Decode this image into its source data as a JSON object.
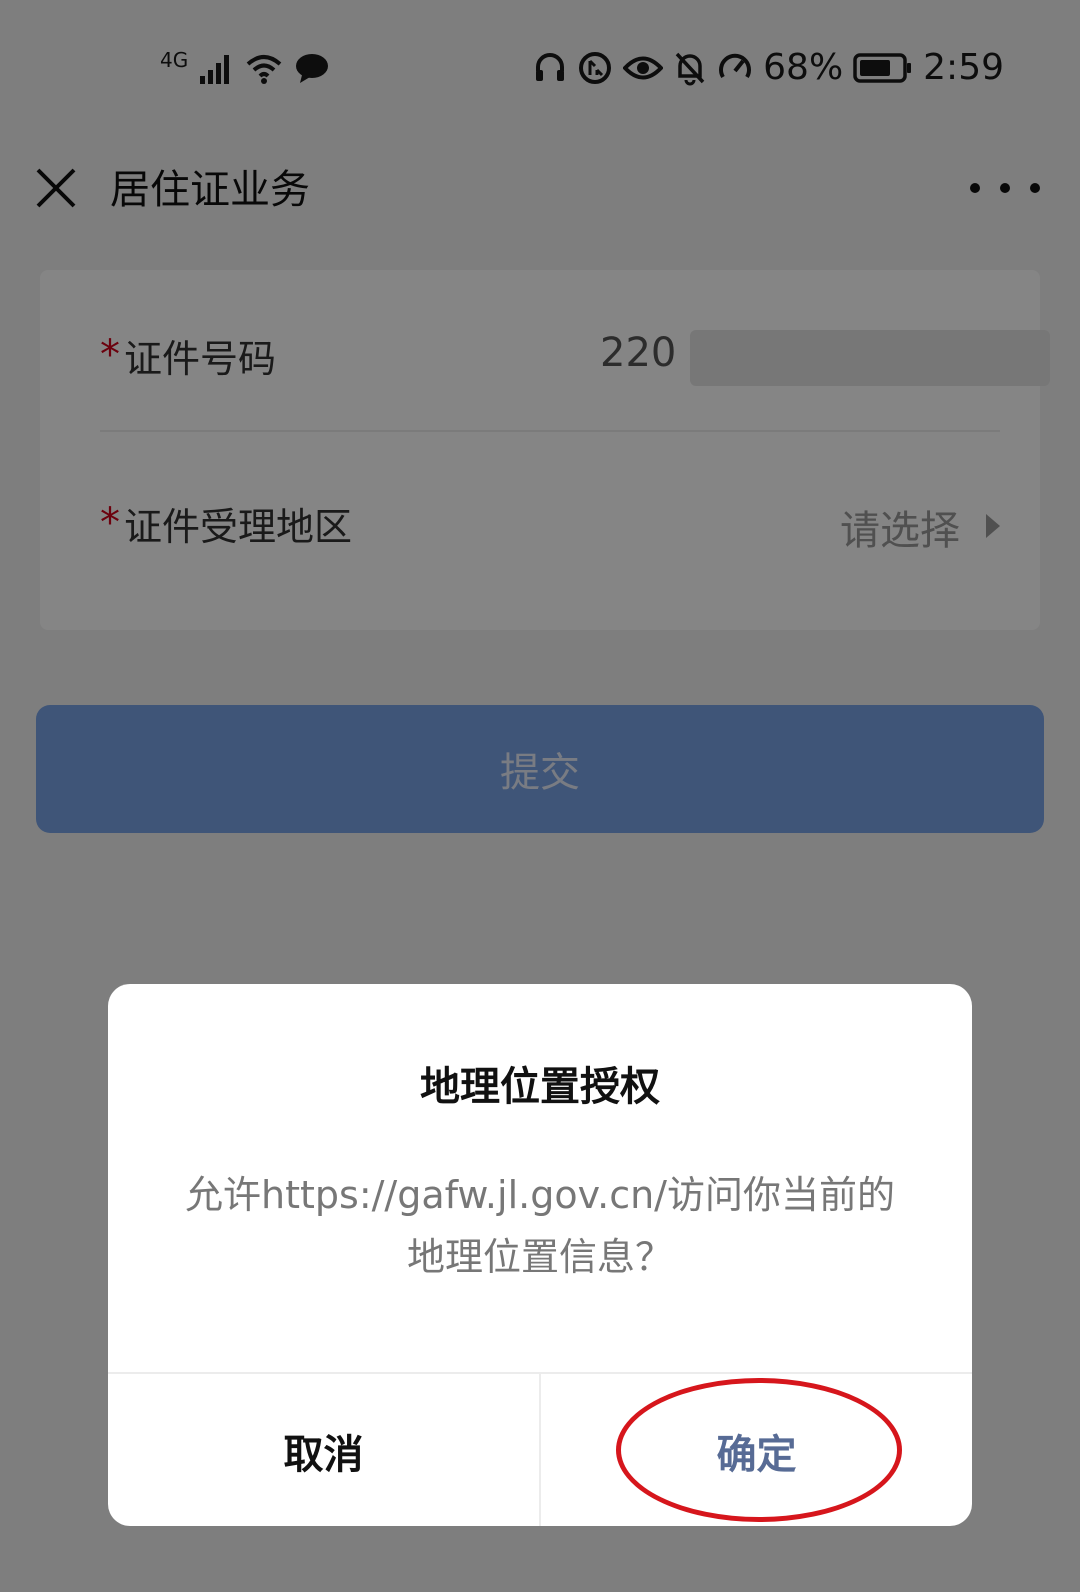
{
  "status_bar": {
    "network_label": "4G",
    "battery_percent": "68%",
    "time": "2:59"
  },
  "title_bar": {
    "title": "居住证业务"
  },
  "form": {
    "id_number": {
      "required_mark": "*",
      "label": "证件号码",
      "value_visible": "220"
    },
    "region": {
      "required_mark": "*",
      "label": "证件受理地区",
      "placeholder": "请选择"
    }
  },
  "submit_label": "提交",
  "dialog": {
    "title": "地理位置授权",
    "message": "允许https://gafw.jl.gov.cn/访问你当前的地理位置信息？",
    "cancel_label": "取消",
    "confirm_label": "确定"
  },
  "colors": {
    "primary_button": "#7aa3e6",
    "confirm_text": "#576b95",
    "required": "#d0021b",
    "annotation": "#d6161c"
  }
}
